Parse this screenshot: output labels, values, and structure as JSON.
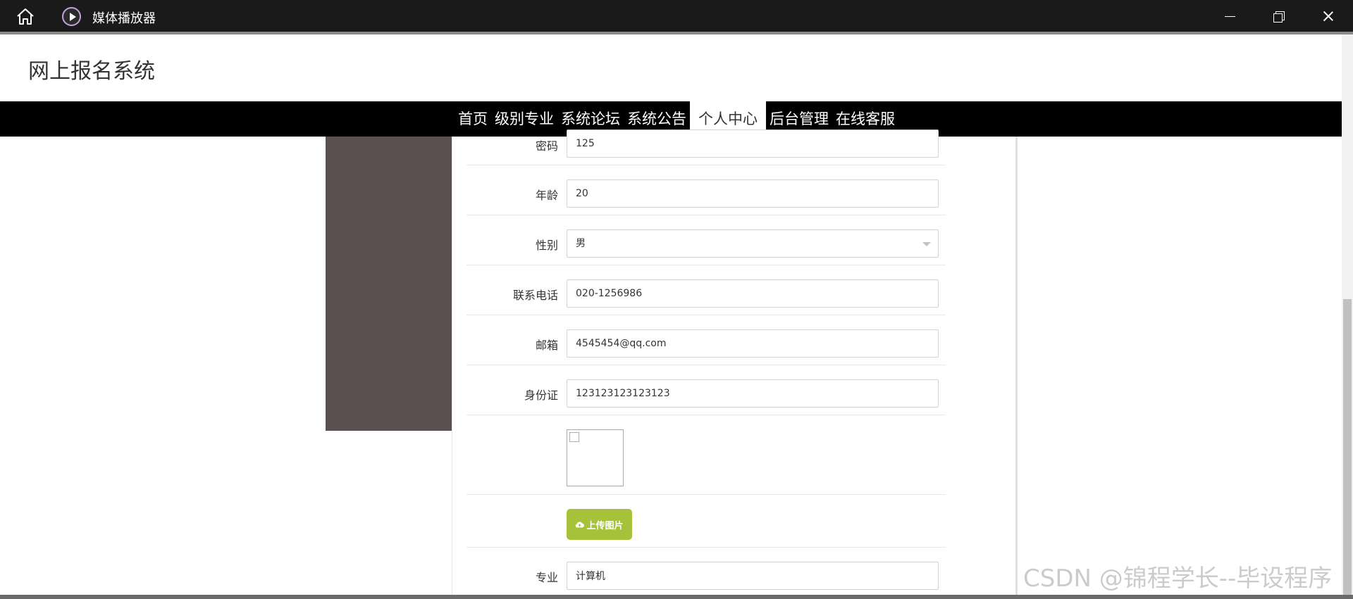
{
  "window": {
    "title": "媒体播放器",
    "icons": [
      "home-icon",
      "media-player-icon",
      "minimize-icon",
      "maximize-icon",
      "close-icon"
    ]
  },
  "site": {
    "title": "网上报名系统"
  },
  "nav": {
    "items": [
      "首页",
      "级别专业",
      "系统论坛",
      "系统公告",
      "个人中心",
      "后台管理",
      "在线客服"
    ],
    "active": "个人中心"
  },
  "form": {
    "password": {
      "label": "密码",
      "value": "125"
    },
    "age": {
      "label": "年龄",
      "value": "20"
    },
    "gender": {
      "label": "性别",
      "value": "男"
    },
    "phone": {
      "label": "联系电话",
      "value": "020-1256986"
    },
    "email": {
      "label": "邮箱",
      "value": "4545454@qq.com"
    },
    "id_card": {
      "label": "身份证",
      "value": "123123123123123"
    },
    "upload_label": "上传图片",
    "major": {
      "label": "专业",
      "value": "计算机"
    }
  },
  "watermark": "CSDN @锦程学长--毕设程序",
  "colors": {
    "nav_bg": "#000000",
    "side_panel": "#5a5050",
    "upload_button": "#a6c23a",
    "titlebar": "#1a1a1a"
  }
}
